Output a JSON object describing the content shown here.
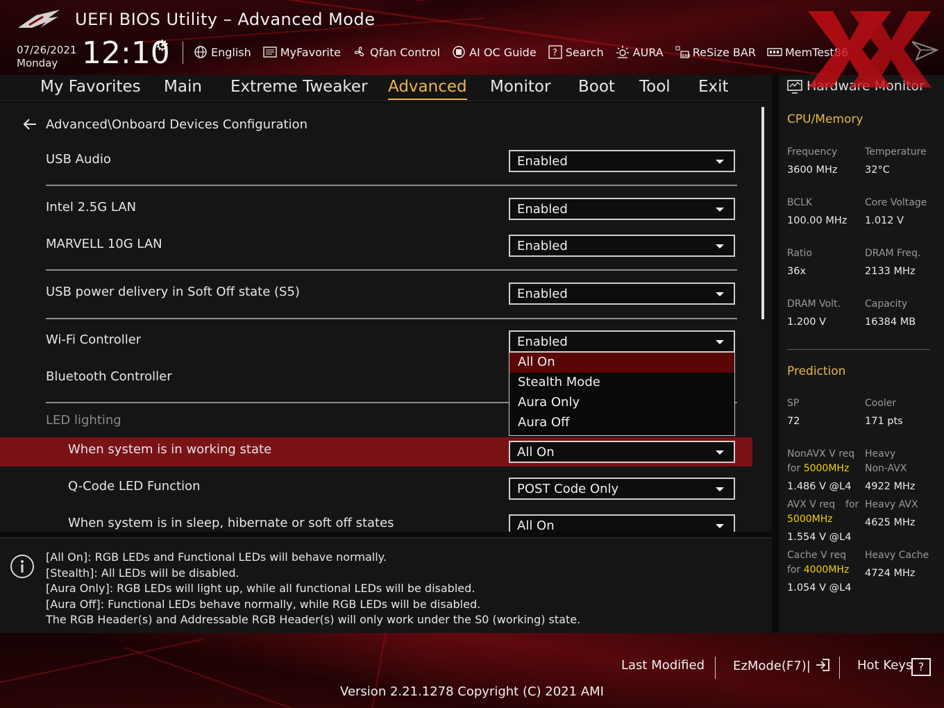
{
  "header": {
    "title": "UEFI BIOS Utility – Advanced Mode",
    "date": "07/26/2021",
    "day": "Monday",
    "time": "12:10",
    "toolbar": [
      {
        "label": "English",
        "icon": "globe-icon"
      },
      {
        "label": "MyFavorite",
        "icon": "favorite-list-icon"
      },
      {
        "label": "Qfan Control",
        "icon": "fan-icon"
      },
      {
        "label": "AI OC Guide",
        "icon": "ai-chip-icon"
      },
      {
        "label": "Search",
        "icon": "question-box-icon"
      },
      {
        "label": "AURA",
        "icon": "aura-light-icon"
      },
      {
        "label": "ReSize BAR",
        "icon": "resize-bar-icon"
      },
      {
        "label": "MemTest86",
        "icon": "memory-icon"
      }
    ]
  },
  "nav": {
    "tabs": [
      "My Favorites",
      "Main",
      "Extreme Tweaker",
      "Advanced",
      "Monitor",
      "Boot",
      "Tool",
      "Exit"
    ],
    "active": "Advanced"
  },
  "main": {
    "breadcrumb": "Advanced\\Onboard Devices Configuration",
    "rows": [
      {
        "label": "USB Audio",
        "value": "Enabled"
      },
      {
        "label": "Intel 2.5G LAN",
        "value": "Enabled"
      },
      {
        "label": "MARVELL 10G LAN",
        "value": "Enabled"
      },
      {
        "label": "USB power delivery in Soft Off state (S5)",
        "value": "Enabled"
      },
      {
        "label": "Wi-Fi Controller",
        "value": "Enabled"
      },
      {
        "label": "Bluetooth Controller",
        "value": ""
      },
      {
        "label": "LED lighting",
        "value": ""
      },
      {
        "label": "When system is in working state",
        "value": "All On"
      },
      {
        "label": "Q-Code LED Function",
        "value": "POST Code Only"
      },
      {
        "label": "When system is in sleep, hibernate or soft off states",
        "value": "All On"
      }
    ],
    "popup_options": [
      "All On",
      "Stealth Mode",
      "Aura Only",
      "Aura Off"
    ],
    "popup_selected": "All On"
  },
  "info": {
    "lines": [
      "[All On]: RGB LEDs and Functional LEDs will behave normally.",
      "[Stealth]: All LEDs will be disabled.",
      "[Aura Only]: RGB LEDs will light up, while all functional LEDs will be disabled.",
      "[Aura Off]: Functional LEDs behave normally, while RGB LEDs will be disabled.",
      "The RGB Header(s) and Addressable RGB Header(s) will only work under the S0 (working) state."
    ]
  },
  "hwmon": {
    "title": "Hardware Monitor",
    "cpu_section": "CPU/Memory",
    "cpu": [
      {
        "k": "Frequency",
        "v": "3600 MHz"
      },
      {
        "k": "Temperature",
        "v": "32°C"
      },
      {
        "k": "BCLK",
        "v": "100.00 MHz"
      },
      {
        "k": "Core Voltage",
        "v": "1.012 V"
      },
      {
        "k": "Ratio",
        "v": "36x"
      },
      {
        "k": "DRAM Freq.",
        "v": "2133 MHz"
      },
      {
        "k": "DRAM Volt.",
        "v": "1.200 V"
      },
      {
        "k": "Capacity",
        "v": "16384 MB"
      }
    ],
    "pred_section": "Prediction",
    "sp_k": "SP",
    "sp_v": "72",
    "cooler_k": "Cooler",
    "cooler_v": "171 pts",
    "nonavx_k1": "NonAVX V req",
    "nonavx_k2_pre": "for ",
    "nonavx_freq": "5000MHz",
    "nonavx_v": "1.486 V @L4",
    "heavy_nonavx_k1": "Heavy",
    "heavy_nonavx_k2": "Non-AVX",
    "heavy_nonavx_v": "4922 MHz",
    "avx_k1": "AVX V req",
    "avx_for": "for",
    "avx_freq": "5000MHz",
    "avx_v": "1.554 V @L4",
    "heavy_avx_k": "Heavy AVX",
    "heavy_avx_v": "4625 MHz",
    "cache_k1": "Cache V req",
    "cache_k2_pre": "for ",
    "cache_freq": "4000MHz",
    "cache_v": "1.054 V @L4",
    "heavy_cache_k": "Heavy Cache",
    "heavy_cache_v": "4724 MHz"
  },
  "footer": {
    "last_modified": "Last Modified",
    "ezmode": "EzMode(F7)|",
    "hotkeys": "Hot Keys",
    "hotkeys_box": "?",
    "version": "Version 2.21.1278 Copyright (C) 2021 AMI"
  },
  "colors": {
    "accent": "#e8b84a",
    "highlight_row": "#7a1216",
    "prediction_freq": "#f2d200"
  }
}
